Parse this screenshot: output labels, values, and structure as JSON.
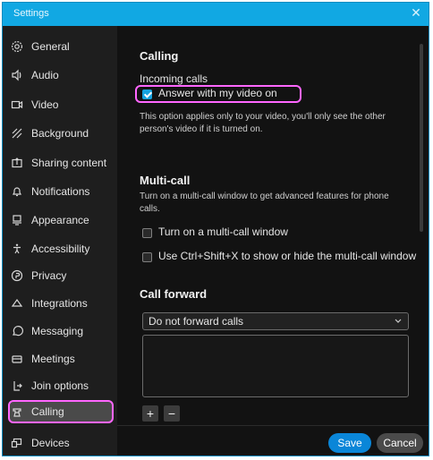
{
  "window": {
    "title": "Settings"
  },
  "sidebar": {
    "items": [
      {
        "label": "General",
        "icon": "gear-icon"
      },
      {
        "label": "Audio",
        "icon": "speaker-icon"
      },
      {
        "label": "Video",
        "icon": "camera-icon"
      },
      {
        "label": "Background",
        "icon": "background-icon"
      },
      {
        "label": "Sharing content",
        "icon": "share-icon"
      },
      {
        "label": "Notifications",
        "icon": "bell-icon"
      },
      {
        "label": "Appearance",
        "icon": "appearance-icon"
      },
      {
        "label": "Accessibility",
        "icon": "accessibility-icon"
      },
      {
        "label": "Privacy",
        "icon": "privacy-icon"
      },
      {
        "label": "Integrations",
        "icon": "integrations-icon"
      },
      {
        "label": "Messaging",
        "icon": "chat-icon"
      },
      {
        "label": "Meetings",
        "icon": "meetings-icon"
      },
      {
        "label": "Join options",
        "icon": "join-icon"
      },
      {
        "label": "Calling",
        "icon": "phone-icon",
        "active": true
      },
      {
        "label": "Devices",
        "icon": "devices-icon"
      }
    ]
  },
  "calling": {
    "section_title": "Calling",
    "incoming_label": "Incoming calls",
    "answer_with_video_label": "Answer with my video on",
    "answer_with_video_checked": true,
    "hint_line1": "This option applies only to your video, you'll only see the other",
    "hint_line2": "person's video if it is turned on."
  },
  "multicall": {
    "section_title": "Multi-call",
    "desc_line1": "Turn on a multi-call window to get advanced features for phone",
    "desc_line2": "calls.",
    "option1_label": "Turn on a multi-call window",
    "option1_checked": false,
    "option2_label": "Use Ctrl+Shift+X to show or hide the multi-call window",
    "option2_checked": false
  },
  "callforward": {
    "section_title": "Call forward",
    "dropdown_value": "Do not forward calls",
    "add_label": "+",
    "remove_label": "−"
  },
  "footer": {
    "save_label": "Save",
    "cancel_label": "Cancel"
  },
  "colors": {
    "accent": "#16a3df",
    "highlight": "#ff66ff",
    "window_frame": "#11a8e3",
    "sidebar_bg": "#1e1e1e",
    "content_bg": "#121212"
  }
}
